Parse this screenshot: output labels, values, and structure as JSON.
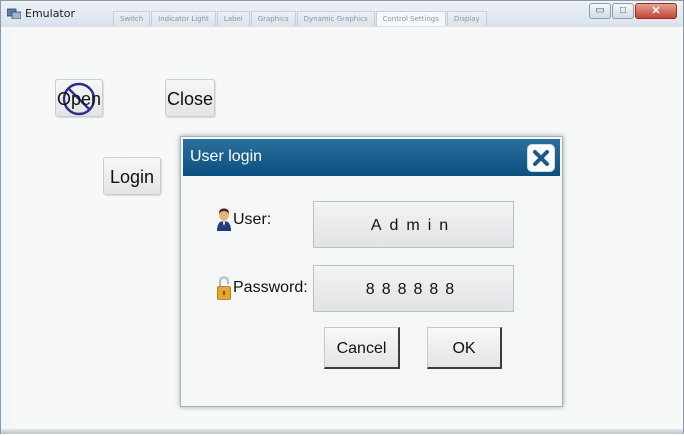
{
  "window": {
    "title": "Emulator",
    "tabs": [
      {
        "label": "Switch"
      },
      {
        "label": "Indicator Light"
      },
      {
        "label": "Label"
      },
      {
        "label": "Graphics"
      },
      {
        "label": "Dynamic Graphics"
      },
      {
        "label": "Control Settings"
      },
      {
        "label": "Display"
      }
    ],
    "minimize_glyph": "▭",
    "maximize_glyph": "□",
    "close_glyph": "✕"
  },
  "main": {
    "open_label": "Open",
    "close_label": "Close",
    "login_label": "Login"
  },
  "dialog": {
    "title": "User login",
    "user_label": "User:",
    "user_value": "Admin",
    "password_label": "Password:",
    "password_value": "888888",
    "cancel_label": "Cancel",
    "ok_label": "OK"
  },
  "colors": {
    "dialog_header": "#0b4f80",
    "window_close": "#c4442e",
    "client_bg": "#f6f9f8"
  },
  "icons": {
    "app": "emulator-icon",
    "open_disabled": "no-entry-icon",
    "user": "user-icon",
    "password": "lock-icon",
    "dialog_close": "close-icon"
  }
}
